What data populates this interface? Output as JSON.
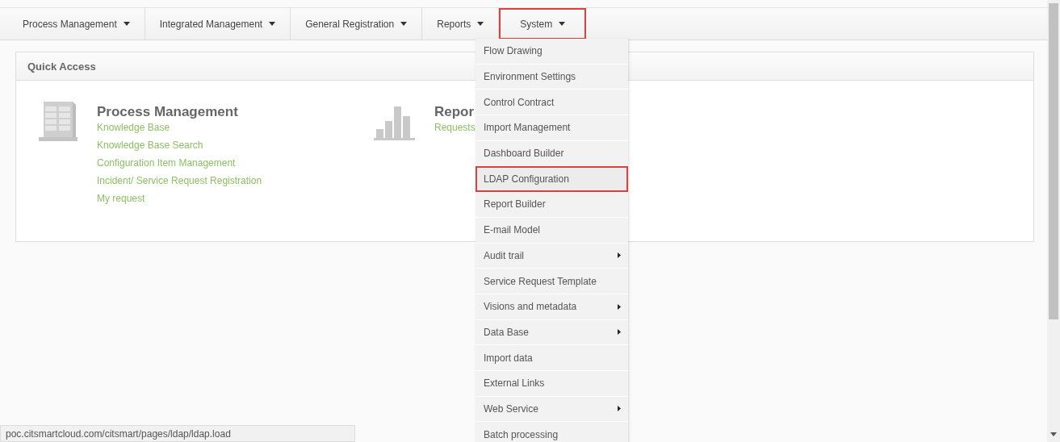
{
  "nav": [
    {
      "label": "Process Management",
      "highlighted": false
    },
    {
      "label": "Integrated Management",
      "highlighted": false
    },
    {
      "label": "General Registration",
      "highlighted": false
    },
    {
      "label": "Reports",
      "highlighted": false
    },
    {
      "label": "System",
      "highlighted": true
    }
  ],
  "quick_access": {
    "title": "Quick Access",
    "sections": [
      {
        "kind": "stack",
        "title": "Process Management",
        "links": [
          "Knowledge Base",
          "Knowledge Base Search",
          "Configuration Item Management",
          "Incident/ Service Request Registration",
          "My request"
        ]
      },
      {
        "kind": "chart",
        "title": "Repor",
        "links": [
          "Requests"
        ]
      }
    ]
  },
  "system_menu": [
    {
      "label": "Flow Drawing",
      "highlighted": false,
      "submenu": false
    },
    {
      "label": "Environment Settings",
      "highlighted": false,
      "submenu": false
    },
    {
      "label": "Control Contract",
      "highlighted": false,
      "submenu": false
    },
    {
      "label": "Import Management",
      "highlighted": false,
      "submenu": false
    },
    {
      "label": "Dashboard Builder",
      "highlighted": false,
      "submenu": false
    },
    {
      "label": "LDAP Configuration",
      "highlighted": true,
      "submenu": false
    },
    {
      "label": "Report Builder",
      "highlighted": false,
      "submenu": false
    },
    {
      "label": "E-mail Model",
      "highlighted": false,
      "submenu": false
    },
    {
      "label": "Audit trail",
      "highlighted": false,
      "submenu": true
    },
    {
      "label": "Service Request Template",
      "highlighted": false,
      "submenu": false
    },
    {
      "label": "Visions and metadata",
      "highlighted": false,
      "submenu": true
    },
    {
      "label": "Data Base",
      "highlighted": false,
      "submenu": true
    },
    {
      "label": "Import data",
      "highlighted": false,
      "submenu": false
    },
    {
      "label": "External Links",
      "highlighted": false,
      "submenu": false
    },
    {
      "label": "Web Service",
      "highlighted": false,
      "submenu": true
    },
    {
      "label": "Batch processing",
      "highlighted": false,
      "submenu": false
    }
  ],
  "status_bar": {
    "url": "poc.citsmartcloud.com/citsmart/pages/ldap/ldap.load"
  }
}
